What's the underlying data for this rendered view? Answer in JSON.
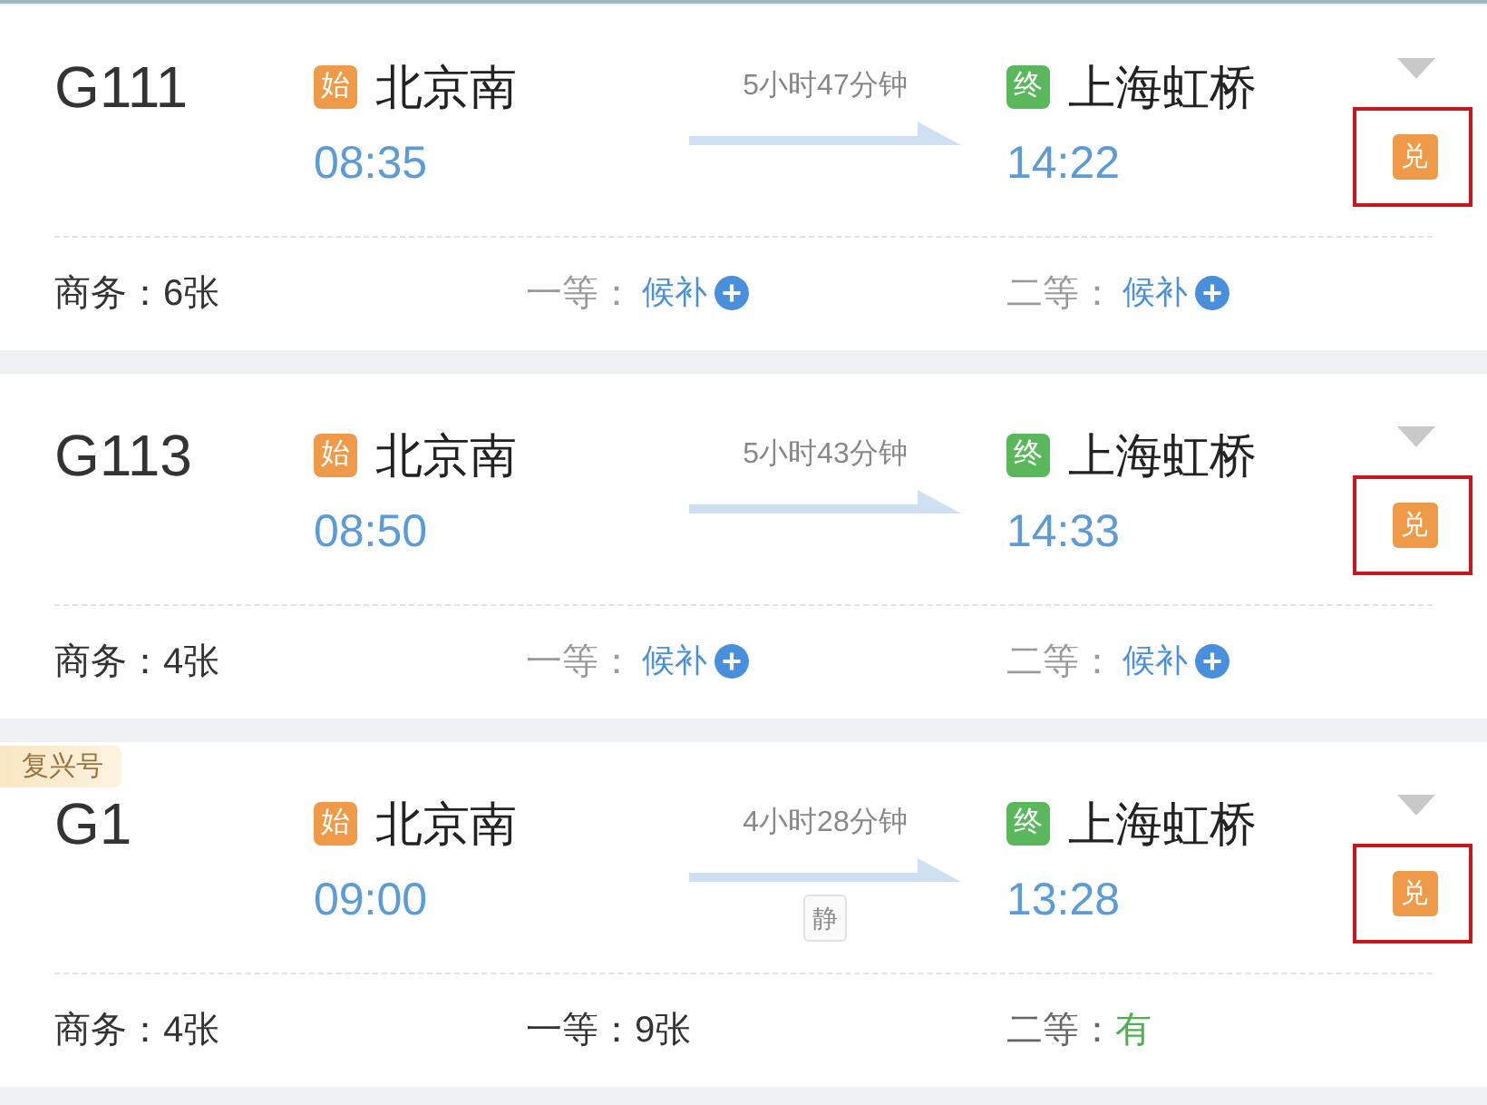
{
  "trains": [
    {
      "number": "G111",
      "from": {
        "mark": "始",
        "station": "北京南",
        "time": "08:35"
      },
      "duration": "5小时47分钟",
      "to": {
        "mark": "终",
        "station": "上海虹桥",
        "time": "14:22"
      },
      "exchange": {
        "label": "兑",
        "highlighted": true
      },
      "seats": [
        {
          "label": "商务：",
          "value": "6张",
          "kind": "count"
        },
        {
          "label": "一等：",
          "value": "候补",
          "kind": "waitlist"
        },
        {
          "label": "二等：",
          "value": "候补",
          "kind": "waitlist"
        }
      ]
    },
    {
      "number": "G113",
      "from": {
        "mark": "始",
        "station": "北京南",
        "time": "08:50"
      },
      "duration": "5小时43分钟",
      "to": {
        "mark": "终",
        "station": "上海虹桥",
        "time": "14:33"
      },
      "exchange": {
        "label": "兑",
        "highlighted": true
      },
      "seats": [
        {
          "label": "商务：",
          "value": "4张",
          "kind": "count"
        },
        {
          "label": "一等：",
          "value": "候补",
          "kind": "waitlist"
        },
        {
          "label": "二等：",
          "value": "候补",
          "kind": "waitlist"
        }
      ]
    },
    {
      "tag": "复兴号",
      "number": "G1",
      "from": {
        "mark": "始",
        "station": "北京南",
        "time": "09:00"
      },
      "duration": "4小时28分钟",
      "quiet": "静",
      "to": {
        "mark": "终",
        "station": "上海虹桥",
        "time": "13:28"
      },
      "exchange": {
        "label": "兑",
        "highlighted": true
      },
      "seats": [
        {
          "label": "商务：",
          "value": "4张",
          "kind": "count"
        },
        {
          "label": "一等：",
          "value": "9张",
          "kind": "count"
        },
        {
          "label": "二等：",
          "value": "有",
          "kind": "available"
        }
      ]
    }
  ]
}
